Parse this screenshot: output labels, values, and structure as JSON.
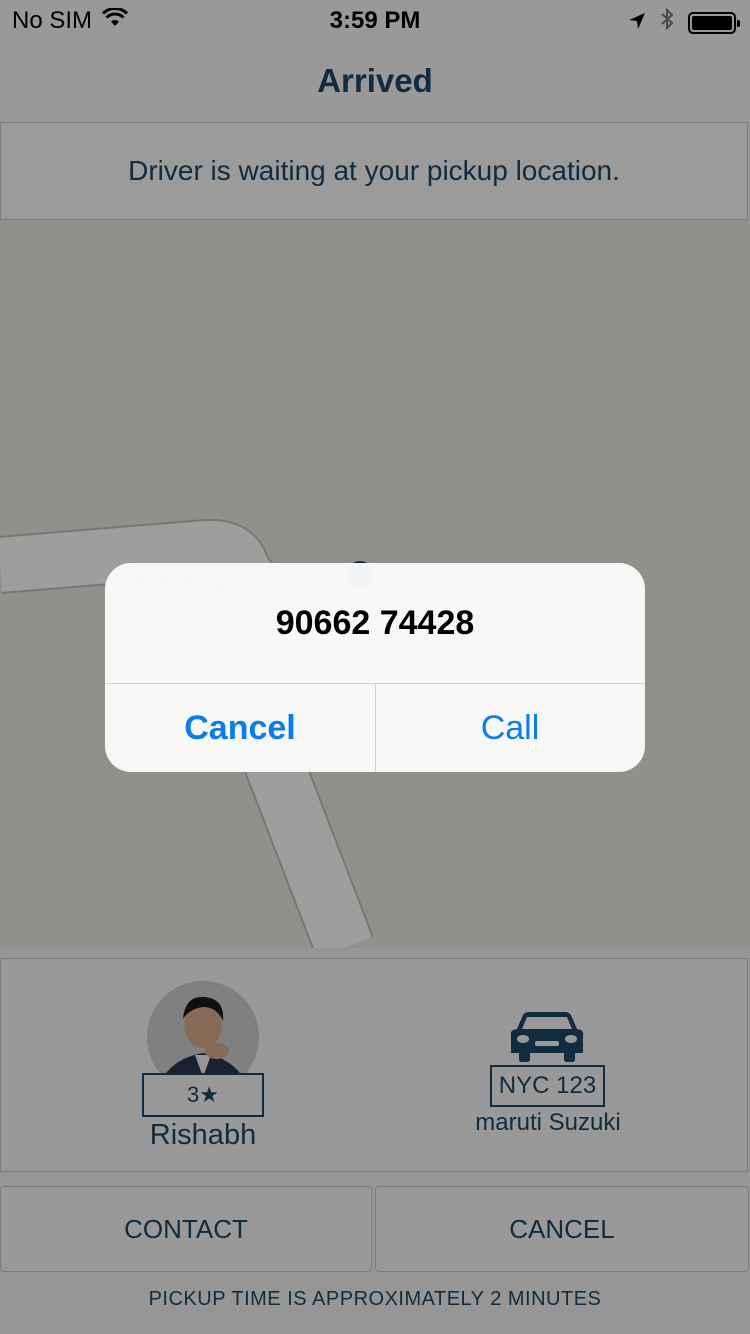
{
  "status_bar": {
    "carrier": "No SIM",
    "time": "3:59 PM",
    "icons": [
      "wifi-icon",
      "location-arrow-icon",
      "bluetooth-icon",
      "battery-icon"
    ]
  },
  "nav": {
    "title": "Arrived"
  },
  "banner": {
    "text": "Driver is waiting at your pickup location."
  },
  "driver": {
    "rating": "3★",
    "name": "Rishabh",
    "avatar_icon": "driver-photo"
  },
  "vehicle": {
    "plate": "NYC 123",
    "model": "maruti Suzuki",
    "icon": "car-icon"
  },
  "actions": {
    "contact_label": "CONTACT",
    "cancel_label": "CANCEL"
  },
  "pickup_note": "PICKUP TIME IS APPROXIMATELY 2 MINUTES",
  "alert": {
    "title": "90662 74428",
    "cancel_label": "Cancel",
    "call_label": "Call"
  },
  "colors": {
    "brand_navy": "#1b4764",
    "ios_blue": "#0a7cf2"
  }
}
